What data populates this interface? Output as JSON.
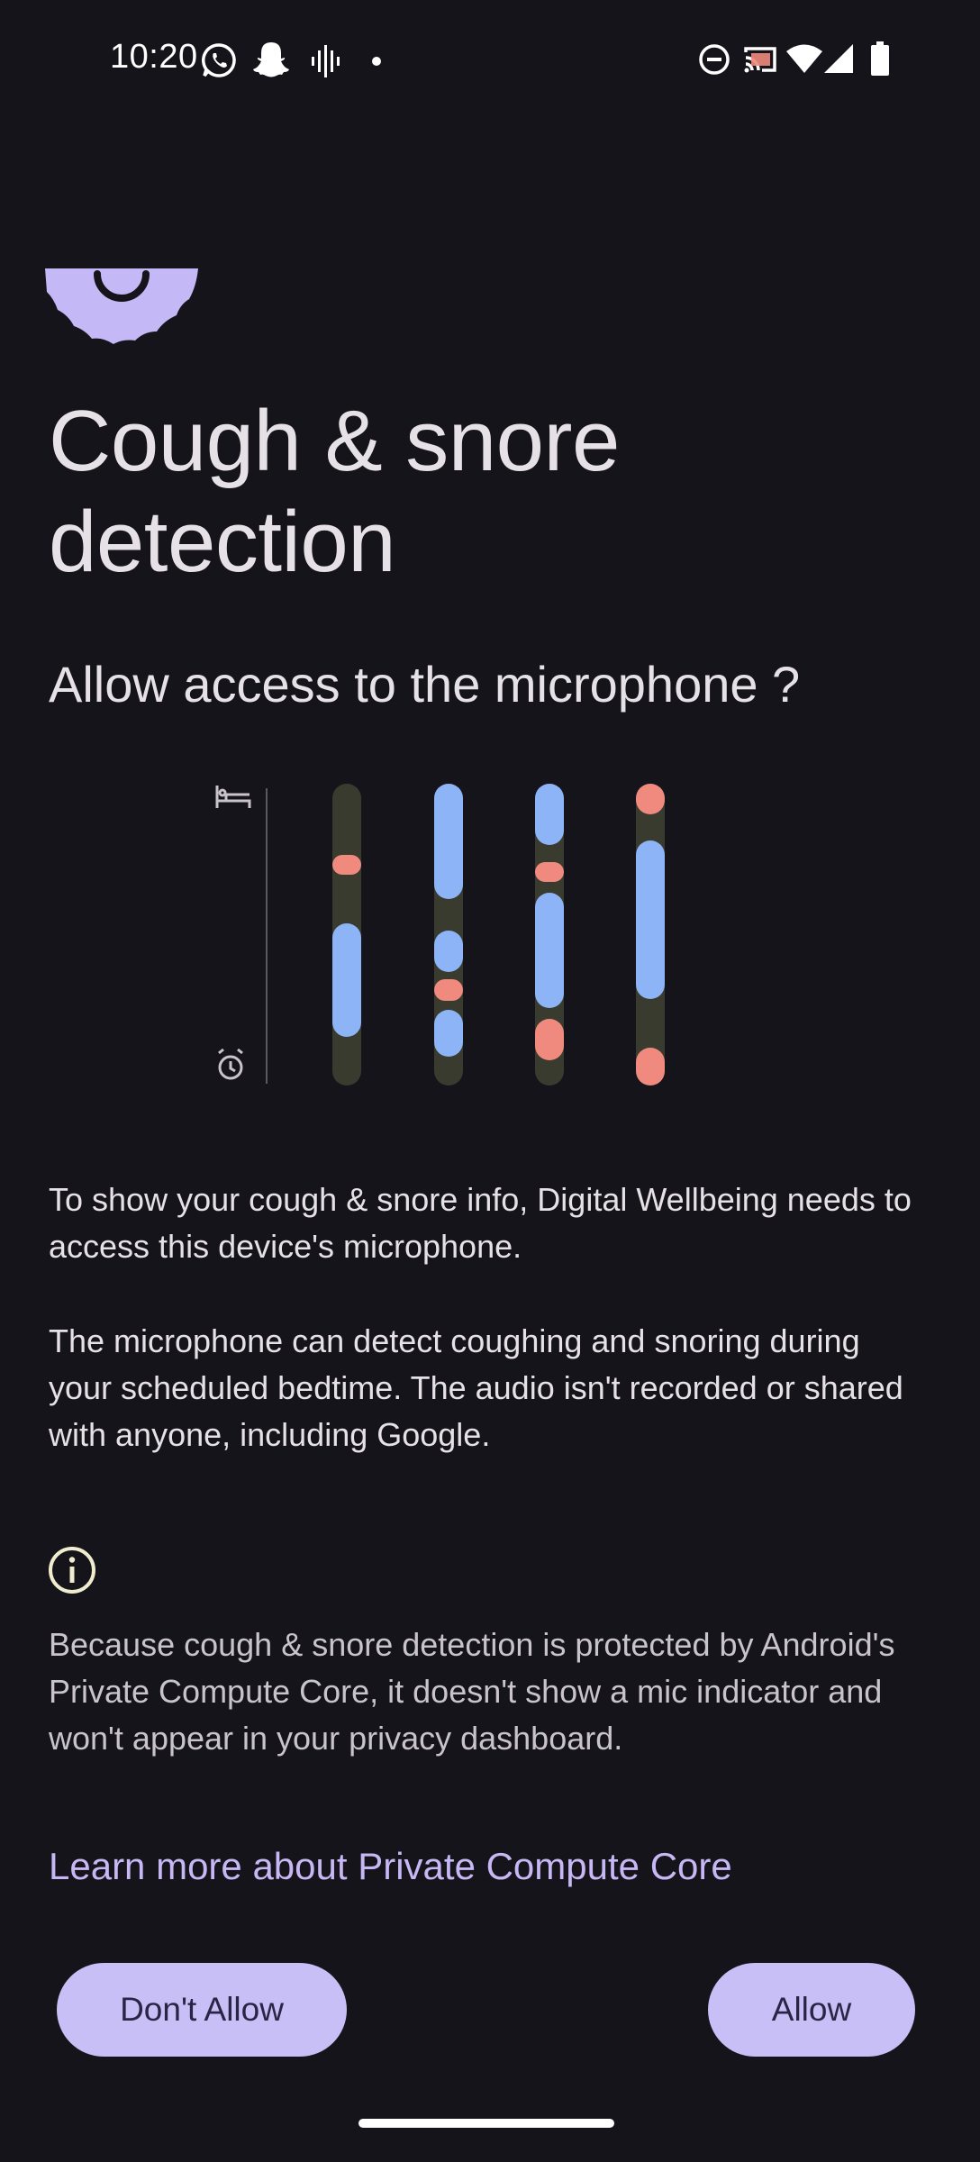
{
  "status_bar": {
    "time": "10:20",
    "left_icons": [
      "whatsapp-icon",
      "snapchat-icon",
      "voice-recorder-icon",
      "notification-dot-icon"
    ],
    "right_icons": [
      "do-not-disturb-icon",
      "cast-icon",
      "wifi-icon",
      "cellular-signal-icon",
      "battery-icon"
    ]
  },
  "header": {
    "icon": "bedtime-moon-icon",
    "icon_color": "#c4b8f6",
    "title": "Cough & snore detection",
    "subtitle": "Allow access to the microphone ?"
  },
  "illustration": {
    "icons": [
      "bed-icon",
      "alarm-clock-icon"
    ],
    "colors": {
      "track": "#3a3b2f",
      "snore": "#8db4f7",
      "cough": "#f08a7e"
    }
  },
  "content": {
    "paragraph_1": "To show your cough & snore info, Digital Wellbeing needs to access this device's microphone.",
    "paragraph_2": "The microphone can detect coughing and snoring during your scheduled bedtime. The audio isn't recorded or shared with anyone, including Google.",
    "info_icon": "info-icon",
    "privacy_note": "Because cough & snore detection is protected by Android's Private Compute Core, it doesn't show a mic indicator and won't appear in your privacy dashboard.",
    "learn_more_link": "Learn more about Private Compute Core"
  },
  "actions": {
    "deny_label": "Don't Allow",
    "allow_label": "Allow",
    "button_color": "#c7bff5"
  }
}
